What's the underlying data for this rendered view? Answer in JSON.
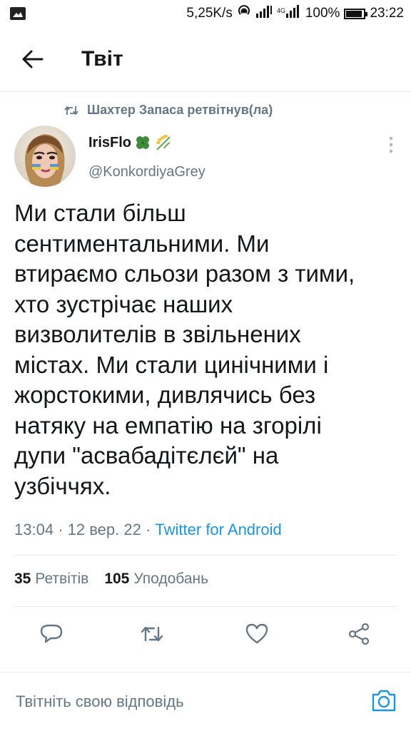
{
  "status_bar": {
    "network_speed": "5,25K/s",
    "battery": "100%",
    "time": "23:22",
    "battery_level": 1.0,
    "icons": [
      "image-icon",
      "hotspot-icon",
      "signal-icon",
      "4g-signal-icon",
      "battery-icon"
    ]
  },
  "header": {
    "title": "Твіт",
    "back_icon": "arrow-left-icon"
  },
  "tweet": {
    "retweeted_by": "Шахтер Запаса ретвітнув(ла)",
    "author_name": "IrisFlo",
    "author_emoji": [
      "four-leaf-clover",
      "rice-stalk"
    ],
    "author_handle": "@KonkordiyaGrey",
    "text": "Ми стали більш\nсентиментальними. Ми\nвтираємо сльози разом з тими,\nхто зустрічає наших\nвизволителів в звільнених\nмістах. Ми стали цинічними і\nжорстокими, дивлячись без\nнатяку на емпатію на згорілі\nдупи \"асвабадітєлєй\" на\nузбіччях.",
    "time": "13:04",
    "date": "12 вер. 22",
    "separator": "·",
    "client": "Twitter for Android",
    "retweets_count": "35",
    "retweets_label": "Ретвітів",
    "likes_count": "105",
    "likes_label": "Уподобань"
  },
  "reply": {
    "placeholder": "Твітніть свою відповідь"
  },
  "colors": {
    "accent": "#1b95e0",
    "secondary_text": "#657786",
    "divider": "#e6ecf0"
  }
}
